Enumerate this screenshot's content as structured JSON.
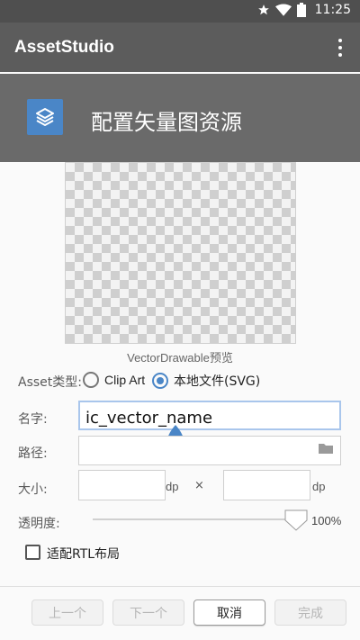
{
  "statusbar": {
    "time": "11:25",
    "icons": [
      "star-icon",
      "wifi-icon",
      "battery-icon"
    ]
  },
  "appbar": {
    "title": "AssetStudio",
    "menu_icon": "overflow-menu-icon"
  },
  "header": {
    "title": "配置矢量图资源",
    "icon": "layers-icon"
  },
  "preview": {
    "caption": "VectorDrawable预览"
  },
  "asset_type": {
    "label": "Asset类型:",
    "options": [
      {
        "label": "Clip Art",
        "selected": false
      },
      {
        "label": "本地文件(SVG)",
        "selected": true
      }
    ]
  },
  "name": {
    "label": "名字:",
    "value": "ic_vector_name"
  },
  "path": {
    "label": "路径:",
    "value": ""
  },
  "size": {
    "label": "大小:",
    "width": "",
    "height": "",
    "unit_1": "dp",
    "separator": "×",
    "unit_2": "dp"
  },
  "opacity": {
    "label": "透明度:",
    "value_percent": 100,
    "text": "100%"
  },
  "rtl": {
    "label": "适配RTL布局",
    "checked": false
  },
  "buttons": {
    "prev": "上一个",
    "next": "下一个",
    "cancel": "取消",
    "finish": "完成"
  },
  "colors": {
    "accent": "#4a86c7",
    "appbar": "#5c5c5c",
    "header": "#6a6a6a",
    "statusbar": "#4f4f4f"
  }
}
